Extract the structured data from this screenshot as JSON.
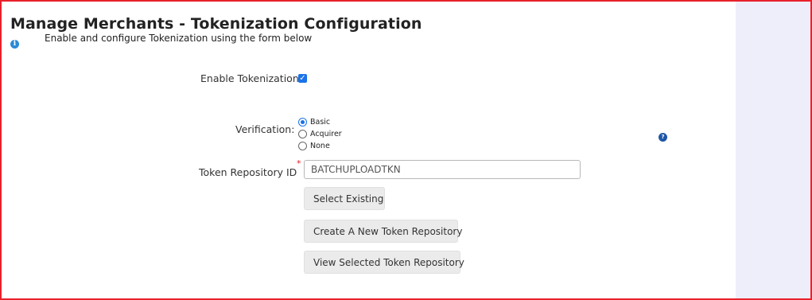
{
  "page": {
    "title": "Manage Merchants - Tokenization Configuration",
    "subtitle": "Enable and configure Tokenization using the form below"
  },
  "form": {
    "enable_tokenization": {
      "label": "Enable Tokenization",
      "checked": true
    },
    "verification": {
      "label": "Verification:",
      "options": [
        "Basic",
        "Acquirer",
        "None"
      ],
      "selected": "Basic"
    },
    "token_repository": {
      "label": "Token Repository ID",
      "required_marker": "*",
      "value": "BATCHUPLOADTKN"
    }
  },
  "buttons": {
    "select_existing": "Select Existing",
    "create_new": "Create A New Token Repository",
    "view_selected": "View Selected Token Repository"
  },
  "icons": {
    "info": "info-icon",
    "help": "help-icon"
  },
  "colors": {
    "border": "#e8212b",
    "accent": "#1a73e8",
    "side_panel": "#eeeefb",
    "required": "#e0202a"
  }
}
